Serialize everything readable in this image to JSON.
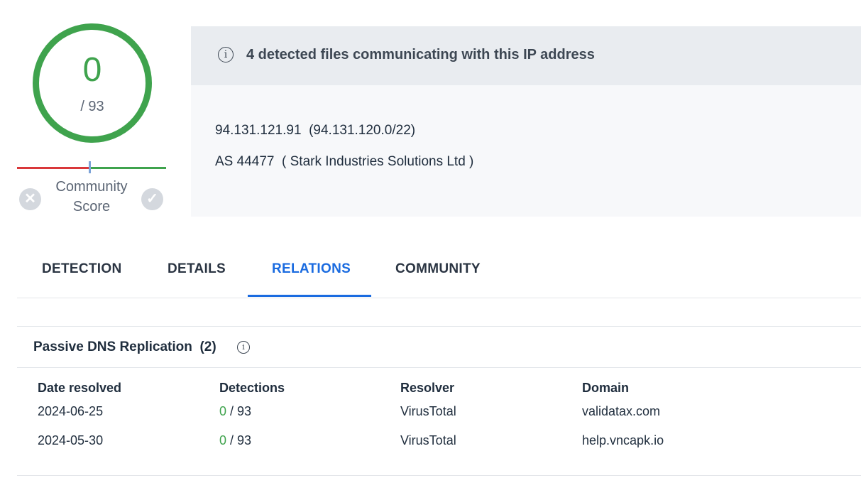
{
  "score": {
    "value": "0",
    "total": "/ 93",
    "ring_color": "#3fa34d"
  },
  "community": {
    "label_line1": "Community",
    "label_line2": "Score",
    "dislike_icon": "close-circle-icon",
    "like_icon": "check-circle-icon"
  },
  "info": {
    "banner": "4 detected files communicating with this IP address",
    "ip": "94.131.121.91",
    "range": "(94.131.120.0/22)",
    "as_number": "AS 44477",
    "as_owner": "( Stark Industries Solutions Ltd )"
  },
  "tabs": [
    {
      "label": "DETECTION"
    },
    {
      "label": "DETAILS"
    },
    {
      "label": "RELATIONS",
      "active": true
    },
    {
      "label": "COMMUNITY"
    }
  ],
  "passive_dns": {
    "title": "Passive DNS Replication",
    "count": "(2)",
    "columns": [
      "Date resolved",
      "Detections",
      "Resolver",
      "Domain"
    ],
    "rows": [
      {
        "date": "2024-06-25",
        "detections": "0",
        "detections_total": "/ 93",
        "resolver": "VirusTotal",
        "domain": "validatax.com"
      },
      {
        "date": "2024-05-30",
        "detections": "0",
        "detections_total": "/ 93",
        "resolver": "VirusTotal",
        "domain": "help.vncapk.io"
      }
    ]
  },
  "colors": {
    "accent": "#1a6be0",
    "clean": "#3fa34d",
    "malicious": "#d9383a"
  }
}
